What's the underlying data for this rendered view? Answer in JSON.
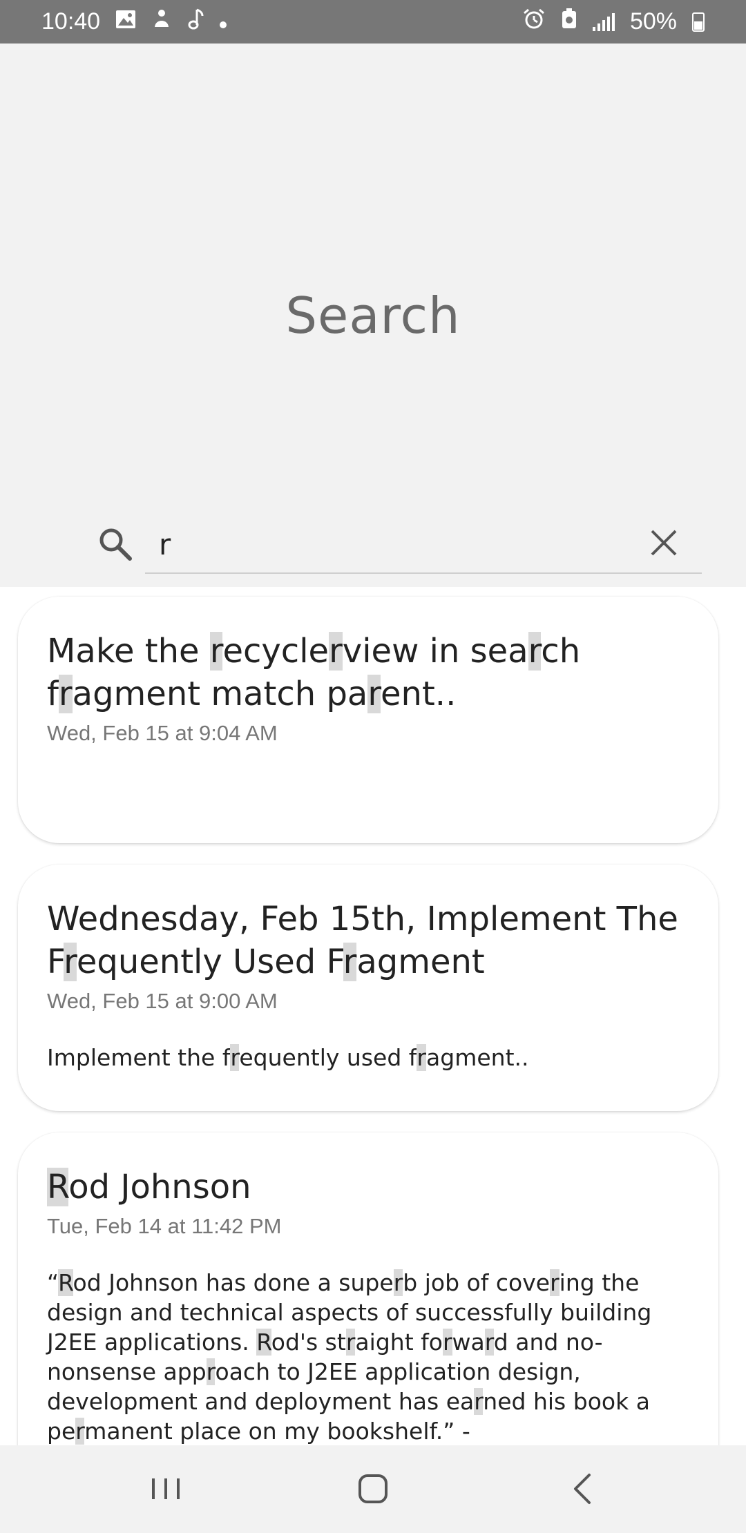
{
  "status_bar": {
    "time": "10:40",
    "battery": "50%",
    "left_icons": [
      "image-icon",
      "notification-icon",
      "music-note-icon",
      "dot-icon"
    ],
    "right_icons": [
      "alarm-icon",
      "battery-saver-icon",
      "signal-icon",
      "battery-icon"
    ]
  },
  "header": {
    "title": "Search"
  },
  "search": {
    "value": "r",
    "icon": "search-icon",
    "clear_icon": "close-icon"
  },
  "results": [
    {
      "title": "Make the recyclerview in search fragment match parent..",
      "date": "Wed, Feb 15 at 9:04 AM",
      "body": ""
    },
    {
      "title": "Wednesday, Feb 15th, Implement The Frequently Used Fragment",
      "date": "Wed, Feb 15 at 9:00 AM",
      "body": "Implement the frequently used fragment.."
    },
    {
      "title": "Rod Johnson",
      "date": "Tue, Feb 14 at 11:42 PM",
      "body": "“Rod Johnson has done a superb job of covering the design and technical aspects of successfully building J2EE applications. Rod's straight forward and no-nonsense approach to J2EE application design, development and deployment has earned his book a permanent place on my bookshelf.” -"
    }
  ],
  "highlight_color": "#d9d9d9",
  "nav_bar": {
    "buttons": [
      "recent-apps-icon",
      "home-icon",
      "back-icon"
    ]
  }
}
